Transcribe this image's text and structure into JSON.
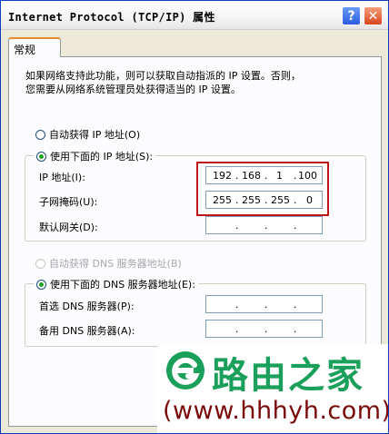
{
  "window": {
    "title": "Internet Protocol (TCP/IP) 属性",
    "help_glyph": "?",
    "close_glyph": "✕"
  },
  "tabs": [
    {
      "label": "常规"
    }
  ],
  "intro": {
    "line1": "如果网络支持此功能，则可以获取自动指派的 IP 设置。否则，",
    "line2": "您需要从网络系统管理员处获得适当的 IP 设置。"
  },
  "ip_section": {
    "auto_label": "自动获得 IP 地址(O)",
    "manual_label": "使用下面的 IP 地址(S):",
    "selected": "manual",
    "fields": [
      {
        "label": "IP 地址(I):",
        "octets": [
          "192",
          "168",
          "1",
          "100"
        ]
      },
      {
        "label": "子网掩码(U):",
        "octets": [
          "255",
          "255",
          "255",
          "0"
        ]
      },
      {
        "label": "默认网关(D):",
        "octets": [
          "",
          "",
          "",
          ""
        ]
      }
    ]
  },
  "dns_section": {
    "auto_label": "自动获得 DNS 服务器地址(B)",
    "manual_label": "使用下面的 DNS 服务器地址(E):",
    "selected": "manual",
    "fields": [
      {
        "label": "首选 DNS 服务器(P):",
        "octets": [
          "",
          "",
          "",
          ""
        ]
      },
      {
        "label": "备用 DNS 服务器(A):",
        "octets": [
          "",
          "",
          "",
          ""
        ]
      }
    ]
  },
  "watermark": {
    "brand": "路由之家",
    "url": "(www.hhhyh.com)",
    "brand_color": "#1aa05a",
    "url_color": "#7a0a0a"
  },
  "colors": {
    "highlight_border": "#c0141b",
    "radio_dot": "#21a121",
    "tab_accent": "#e68b2c"
  }
}
